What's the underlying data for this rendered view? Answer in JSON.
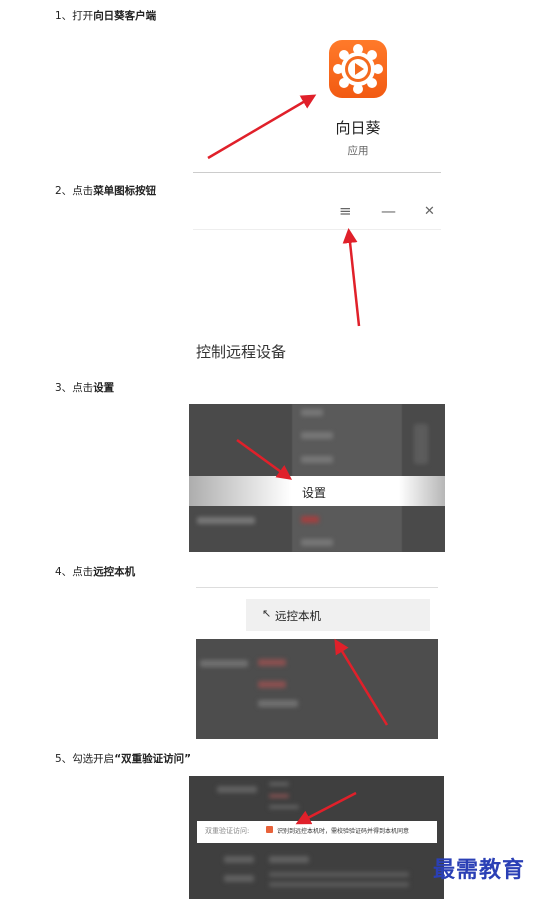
{
  "steps": [
    {
      "num": "1、",
      "prefix": "打开",
      "bold": "向日葵客户端",
      "suffix": ""
    },
    {
      "num": "2、",
      "prefix": "点击",
      "bold": "菜单图标按钮",
      "suffix": ""
    },
    {
      "num": "3、",
      "prefix": "点击",
      "bold": "设置",
      "suffix": ""
    },
    {
      "num": "4、",
      "prefix": "点击",
      "bold": "远控本机",
      "suffix": ""
    },
    {
      "num": "5、",
      "prefix": "勾选开启",
      "bold": "“双重验证访问”",
      "suffix": ""
    }
  ],
  "shot1": {
    "app_name": "向日葵",
    "app_type": "应用"
  },
  "shot2": {
    "menu_glyph": "≡",
    "minimize_glyph": "—",
    "close_glyph": "✕",
    "title": "控制远程设备"
  },
  "shot3": {
    "settings_label": "设置"
  },
  "shot4": {
    "remote_label": "远控本机",
    "cursor_glyph": "↖"
  },
  "shot5": {
    "verify_label": "双重验证访问:",
    "verify_text": "识别到远控本机时，需校验验证码并得到本机同意"
  },
  "watermark": "最需教育",
  "colors": {
    "arrow": "#e0202a",
    "brand": "#f46a1f",
    "watermark": "#2a3fb5"
  }
}
